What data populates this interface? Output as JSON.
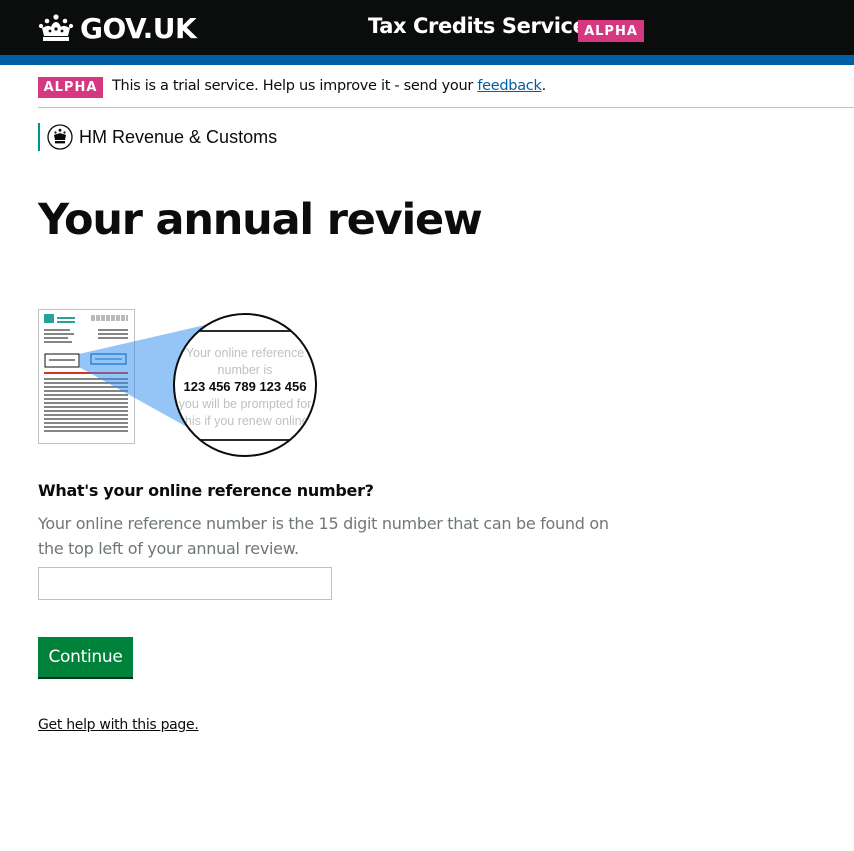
{
  "header": {
    "logo_text": "GOV.UK",
    "service_name": "Tax Credits Service",
    "phase_tag": "ALPHA"
  },
  "phase_banner": {
    "tag": "ALPHA",
    "text_before": "This is a trial service. Help us improve it - send your ",
    "link_text": "feedback",
    "text_after": "."
  },
  "department": {
    "name": "HM Revenue & Customs",
    "icon": "crest-icon"
  },
  "page": {
    "title": "Your annual review"
  },
  "illustration": {
    "magnified_lines": [
      "Your online reference",
      "number is",
      "123 456 789 123 456",
      "you will be prompted for",
      "this if you renew online"
    ]
  },
  "form": {
    "question": "What's your online reference number?",
    "hint": "Your online reference number is the 15 digit number that can be found on the top left of your annual review.",
    "input_value": "",
    "continue_label": "Continue"
  },
  "help_link": "Get help with this page.",
  "colors": {
    "header_bg": "#0b0c0c",
    "header_bar": "#005ea5",
    "alpha_tag": "#d53880",
    "button_green": "#00823b",
    "hmrc_border": "#009390",
    "link_blue": "#005ea5",
    "hint_grey": "#6f777b"
  }
}
